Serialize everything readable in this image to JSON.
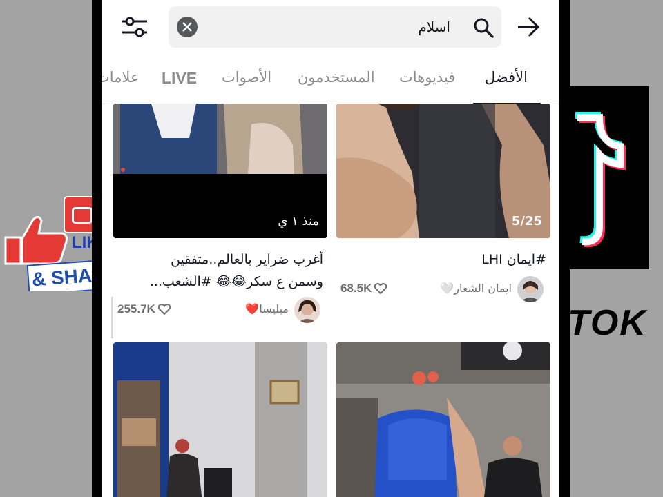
{
  "search": {
    "query": "اسلام"
  },
  "tabs": [
    {
      "label": "الأفضل",
      "active": true
    },
    {
      "label": "فيديوهات",
      "active": false
    },
    {
      "label": "المستخدمون",
      "active": false
    },
    {
      "label": "الأصوات",
      "active": false
    },
    {
      "label": "LIVE",
      "active": false
    },
    {
      "label": "علامات",
      "active": false
    }
  ],
  "videos": [
    {
      "overlay": "5/25",
      "caption_lines": [
        "#ايمان LHI"
      ],
      "user": "ايمان الشعار🤍",
      "likes": "68.5K"
    },
    {
      "overlay": "منذ ١ ي",
      "caption_lines": [
        "أغرب ضراير بالعالم..متفقين",
        "وسمن ع سكر😂😂 #الشعب..."
      ],
      "user": "ميليسا❤️",
      "likes": "255.7K"
    }
  ],
  "decor": {
    "like_label": "LIK",
    "share_label": "& SHA",
    "tiktok_label": "TOK"
  },
  "colors": {
    "accent": "#161823",
    "muted": "#8a8a8e",
    "search_bg": "#f1f1f2",
    "tiktok_cyan": "#25f4ee",
    "tiktok_red": "#fe2c55"
  }
}
